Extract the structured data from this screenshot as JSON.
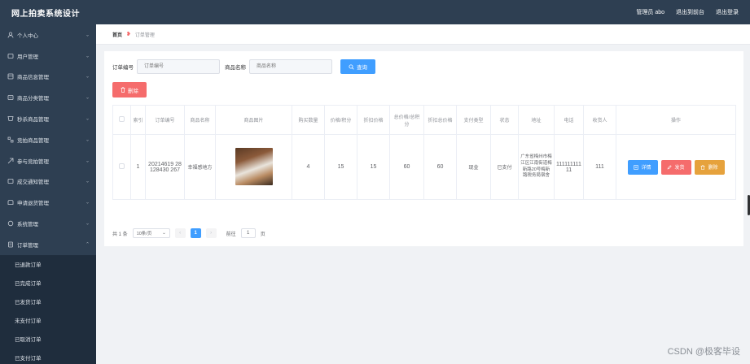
{
  "app": {
    "title": "网上拍卖系统设计",
    "admin_text": "管理员 abo",
    "back_to_front": "退出到前台",
    "logout": "退出登录"
  },
  "sidebar": {
    "items": [
      {
        "label": "个人中心",
        "icon": "user-icon"
      },
      {
        "label": "用户管理",
        "icon": "users-icon"
      },
      {
        "label": "商品信息管理",
        "icon": "goods-icon"
      },
      {
        "label": "商品分类管理",
        "icon": "category-icon"
      },
      {
        "label": "秒杀商品管理",
        "icon": "flash-sale-icon"
      },
      {
        "label": "竞拍商品管理",
        "icon": "auction-icon"
      },
      {
        "label": "参与竞拍管理",
        "icon": "bid-icon"
      },
      {
        "label": "成交通知管理",
        "icon": "notice-icon"
      },
      {
        "label": "申请退货管理",
        "icon": "return-icon"
      },
      {
        "label": "系统管理",
        "icon": "system-icon"
      },
      {
        "label": "订单管理",
        "icon": "order-icon"
      }
    ],
    "order_sub_items": [
      "已退款订单",
      "已完成订单",
      "已发货订单",
      "未支付订单",
      "已取消订单",
      "已支付订单"
    ]
  },
  "breadcrumb": {
    "home": "首页",
    "current": "订单管理"
  },
  "search": {
    "order_no_label": "订单编号",
    "order_no_placeholder": "订单编号",
    "goods_name_label": "商品名称",
    "goods_name_placeholder": "商品名称",
    "query_button": "查询",
    "delete_button": "删除"
  },
  "table": {
    "headers": [
      "索引",
      "订单编号",
      "商品名称",
      "商品图片",
      "购买数量",
      "价格/积分",
      "折扣价格",
      "总价格/总积分",
      "折扣总价格",
      "支付类型",
      "状态",
      "地址",
      "电话",
      "收货人",
      "操作"
    ],
    "rows": [
      {
        "index": "1",
        "order_no": "20214619 28128430 267",
        "goods_name": "幸福感地方",
        "quantity": "4",
        "price": "15",
        "discount_price": "15",
        "total_price": "60",
        "discount_total": "60",
        "pay_type": "现金",
        "status": "已支付",
        "address": "广东省梅州市梅江区江南街道梅新路20号梅新路税务局宿舍",
        "phone": "11111111111",
        "receiver": "111"
      }
    ],
    "ops": {
      "detail": "详情",
      "ship": "发货",
      "delete": "删除"
    }
  },
  "pagination": {
    "total_text": "共 1 条",
    "page_size": "10条/页",
    "current_page": "1",
    "goto_label": "前往",
    "goto_value": "1",
    "page_suffix": "页"
  },
  "watermark": "CSDN @极客毕设"
}
